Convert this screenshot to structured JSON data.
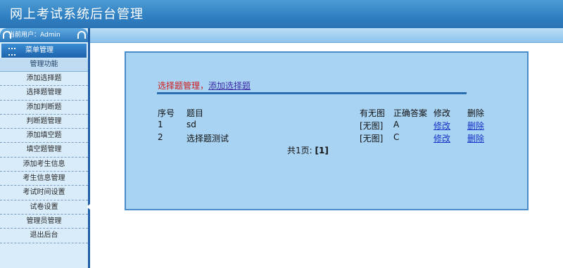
{
  "header": {
    "title": "网上考试系统后台管理"
  },
  "sidebar": {
    "user_label": "当前用户：Admin",
    "menu_title": "菜单管理",
    "section_title": "管理功能",
    "items": [
      {
        "label": "添加选择题"
      },
      {
        "label": "选择题管理"
      },
      {
        "label": "添加判断题"
      },
      {
        "label": "判断题管理"
      },
      {
        "label": "添加填空题"
      },
      {
        "label": "填空题管理"
      },
      {
        "label": "添加考生信息"
      },
      {
        "label": "考生信息管理"
      },
      {
        "label": "考试时间设置"
      },
      {
        "label": "试卷设置"
      },
      {
        "label": "管理员管理"
      },
      {
        "label": "退出后台"
      }
    ]
  },
  "main": {
    "breadcrumb": {
      "current": "选择题管理，",
      "link": "添加选择题"
    },
    "table": {
      "headers": {
        "no": "序号",
        "title": "题目",
        "has_image": "有无图",
        "answer": "正确答案",
        "edit": "修改",
        "delete": "删除"
      },
      "rows": [
        {
          "no": "1",
          "title": "sd",
          "has_image": "[无图]",
          "answer": "A",
          "edit": "修改",
          "delete": "删除"
        },
        {
          "no": "2",
          "title": "选择题测试",
          "has_image": "[无图]",
          "answer": "C",
          "edit": "修改",
          "delete": "删除"
        }
      ]
    },
    "pager": {
      "text": "共1页:",
      "page": "[1]"
    }
  }
}
